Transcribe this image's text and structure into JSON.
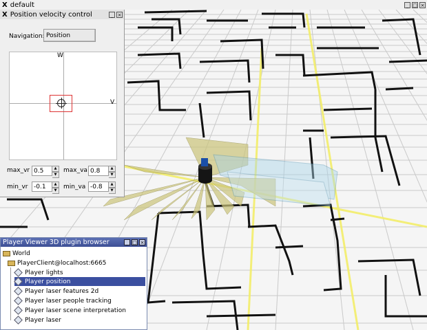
{
  "window": {
    "title": "default"
  },
  "position_control": {
    "title": "Position velocity control",
    "navigation_label": "Navigation:",
    "navigation_value": "Position",
    "axis_w": "W",
    "axis_v": "V",
    "fields": {
      "max_vr_label": "max_vr",
      "max_vr_value": "0.5",
      "max_va_label": "max_va",
      "max_va_value": "0.8",
      "min_vr_label": "min_vr",
      "min_vr_value": "-0.1",
      "min_va_label": "min_va",
      "min_va_value": "-0.8"
    }
  },
  "plugin_browser": {
    "title": "Player Viewer 3D plugin browser",
    "root": "World",
    "client": "PlayerClient@localhost:6665",
    "items": [
      "Player lights",
      "Player position",
      "Player laser features 2d",
      "Player laser people tracking",
      "Player laser scene interpretation",
      "Player laser"
    ],
    "selected_index": 1
  },
  "colors": {
    "grid_line": "#c8c8c8",
    "wall": "#111111",
    "highlight_wall": "#f5f078",
    "laser_fan": "#c8c070",
    "selection": "#3b4fa0"
  }
}
